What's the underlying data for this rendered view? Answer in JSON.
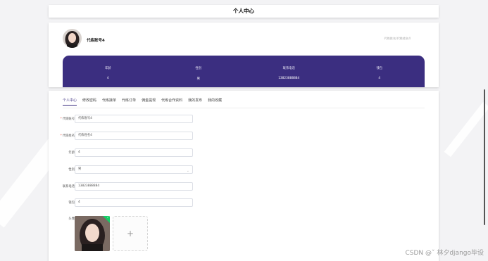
{
  "header": {
    "title": "个人中心"
  },
  "profile": {
    "username": "代练账号4",
    "signature": "代练姓名/代练姓名4",
    "stats": [
      {
        "label": "年龄",
        "value": "4"
      },
      {
        "label": "性别",
        "value": "男"
      },
      {
        "label": "联系电话",
        "value": "13823888884"
      },
      {
        "label": "钱包",
        "value": "4"
      }
    ],
    "colors": {
      "accent": "#3b2e80"
    }
  },
  "tabs": [
    {
      "label": "个人中心",
      "active": true
    },
    {
      "label": "修改密码",
      "active": false
    },
    {
      "label": "代练接单",
      "active": false
    },
    {
      "label": "代练订单",
      "active": false
    },
    {
      "label": "佣金提现",
      "active": false
    },
    {
      "label": "代练合作资料",
      "active": false
    },
    {
      "label": "我的发布",
      "active": false
    },
    {
      "label": "我的收藏",
      "active": false
    }
  ],
  "form": {
    "account_label": "代练账号",
    "account_value": "代练账号4",
    "name_label": "代练姓名",
    "name_value": "代练姓名4",
    "age_label": "年龄",
    "age_value": "4",
    "gender_label": "性别",
    "gender_value": "男",
    "phone_label": "联系电话",
    "phone_value": "13823888884",
    "wallet_label": "钱包",
    "wallet_value": "4",
    "avatar_label": "头像",
    "upload_plus": "+"
  },
  "watermark": "CSDN @ˇ 林夕django毕设"
}
